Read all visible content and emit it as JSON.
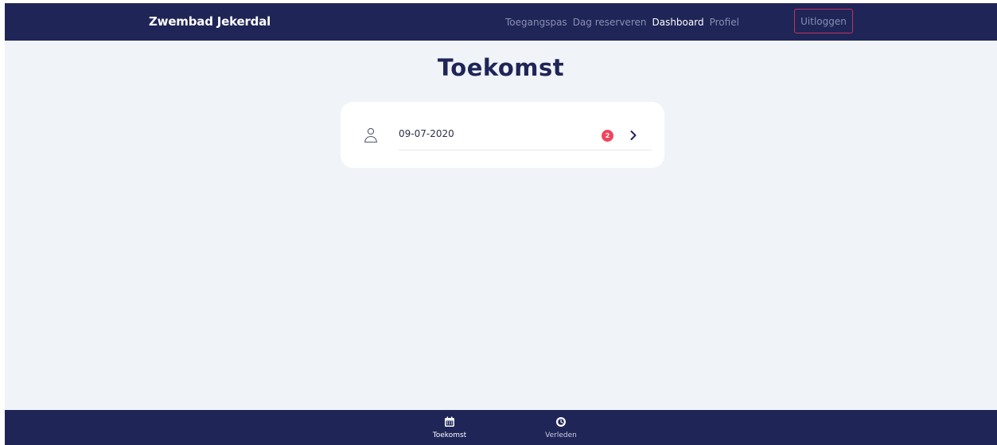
{
  "app": {
    "brand": "Zwembad Jekerdal"
  },
  "nav": {
    "links": [
      {
        "label": "Toegangspas",
        "active": false
      },
      {
        "label": "Dag reserveren",
        "active": false
      },
      {
        "label": "Dashboard",
        "active": true
      },
      {
        "label": "Profiel",
        "active": false
      }
    ],
    "logout_label": "Uitloggen"
  },
  "main": {
    "title": "Toekomst",
    "reservations": [
      {
        "date": "09-07-2020",
        "count": "2",
        "icon": "person-icon",
        "action_icon": "chevron-right-icon"
      }
    ]
  },
  "tabbar": {
    "tabs": [
      {
        "label": "Toekomst",
        "icon": "calendar-icon",
        "active": true
      },
      {
        "label": "Verleden",
        "icon": "history-icon",
        "active": false
      }
    ]
  },
  "colors": {
    "navy": "#1f2557",
    "background": "#f0f3f8",
    "badge": "#f1455e",
    "logout_border": "#c2335a",
    "muted_link": "#8a8fb0"
  }
}
